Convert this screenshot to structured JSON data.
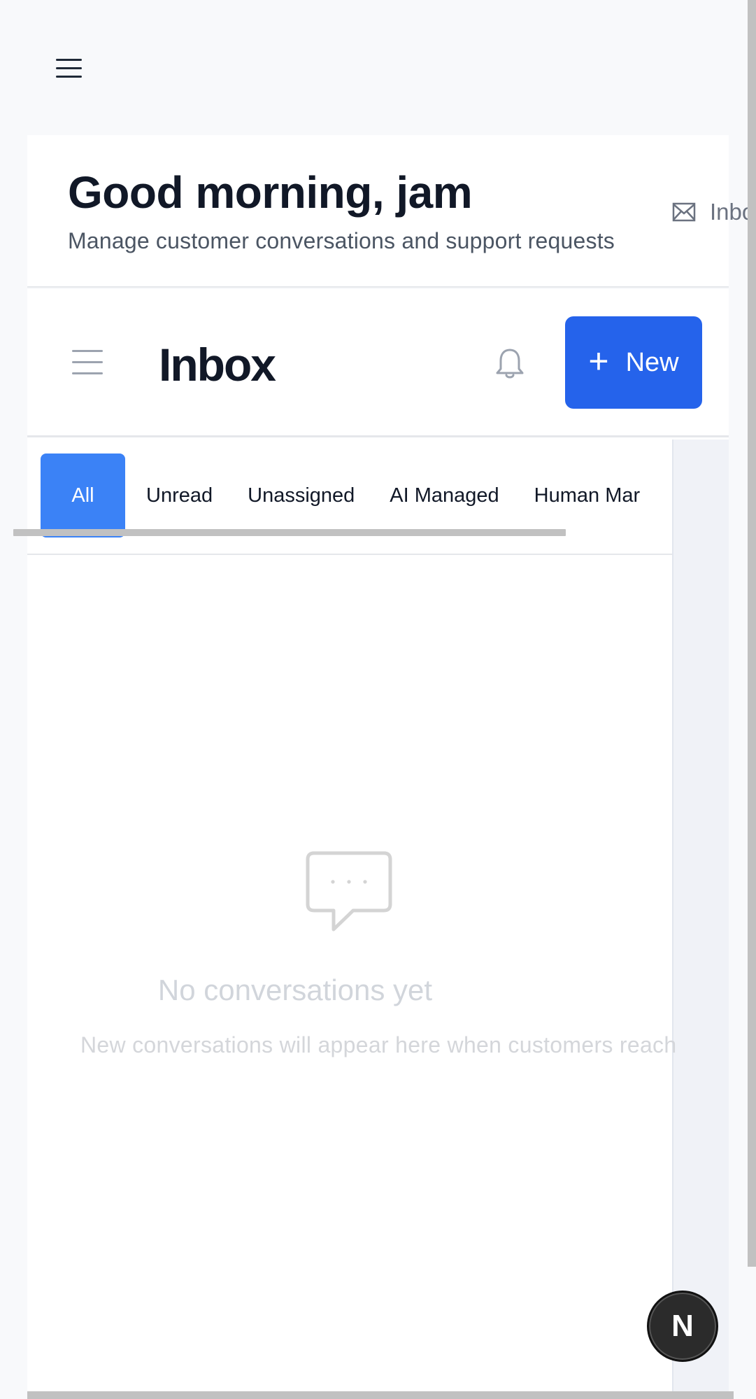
{
  "header": {
    "menu_icon": "hamburger-icon",
    "greeting": "Good morning, jam",
    "subtitle": "Manage customer conversations and support requests",
    "inbox_link_label": "Inbo",
    "inbox_link_icon": "mail-icon"
  },
  "inbox": {
    "title": "Inbox",
    "menu_icon": "hamburger-icon",
    "bell_icon": "bell-icon",
    "new_button_label": "New",
    "new_button_icon": "plus-icon",
    "accent_color": "#2563eb",
    "tabs": [
      {
        "label": "All",
        "active": true
      },
      {
        "label": "Unread",
        "active": false
      },
      {
        "label": "Unassigned",
        "active": false
      },
      {
        "label": "AI Managed",
        "active": false
      },
      {
        "label": "Human Mar",
        "active": false
      }
    ],
    "empty_state": {
      "icon": "chat-bubble-icon",
      "title": "No conversations yet",
      "subtitle": "New conversations will appear here when customers reach"
    }
  },
  "fab": {
    "label": "N"
  }
}
